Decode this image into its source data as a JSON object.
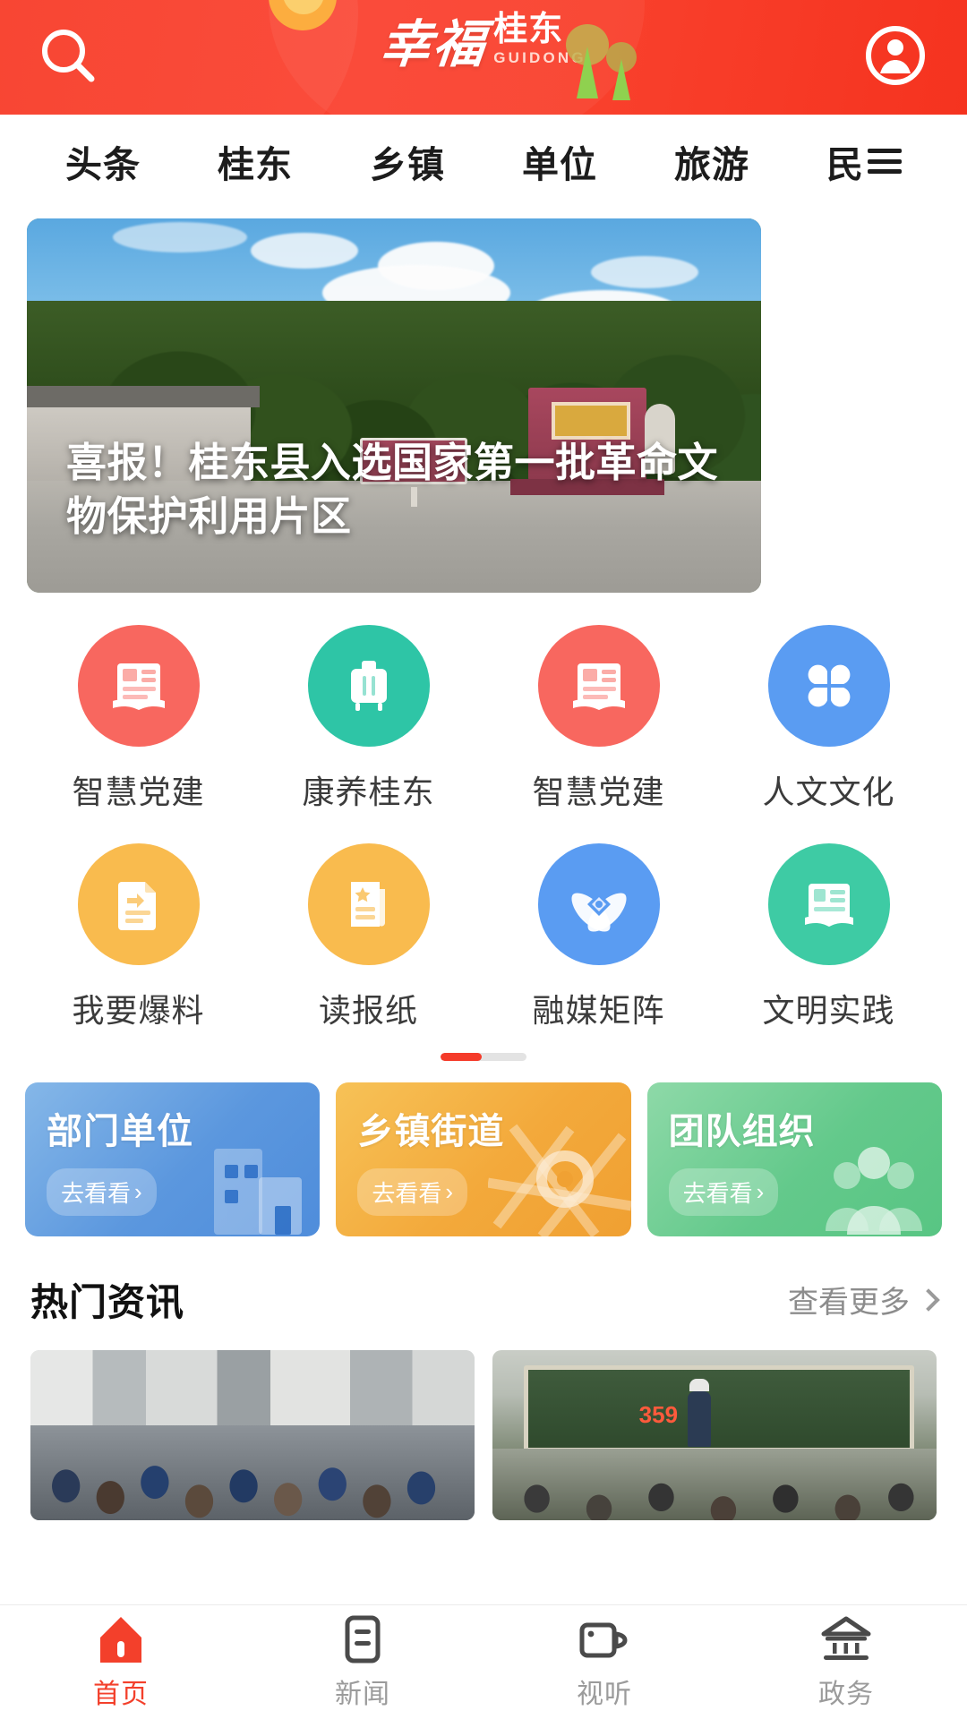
{
  "header": {
    "brand_cn": "幸福",
    "brand_sub": "桂东",
    "brand_en": "GUIDONG",
    "search_icon": "search-icon",
    "profile_icon": "user-avatar-icon",
    "tree_icon": "trees-icon",
    "brand_color": "#f8402b"
  },
  "tabs": [
    {
      "label": "头条"
    },
    {
      "label": "桂东"
    },
    {
      "label": "乡镇"
    },
    {
      "label": "单位"
    },
    {
      "label": "旅游"
    },
    {
      "label": "民"
    }
  ],
  "hero": {
    "title": "喜报！桂东县入选国家第一批革命文物保护利用片区"
  },
  "shortcuts": {
    "rows": [
      [
        {
          "label": "智慧党建",
          "color": "#f8675f",
          "icon": "party-book-icon"
        },
        {
          "label": "康养桂东",
          "color": "#2ec5a6",
          "icon": "suitcase-icon"
        },
        {
          "label": "智慧党建",
          "color": "#f8675f",
          "icon": "party-book-icon"
        },
        {
          "label": "人文文化",
          "color": "#5a9cf2",
          "icon": "four-petal-icon"
        }
      ],
      [
        {
          "label": "我要爆料",
          "color": "#f9bb4e",
          "icon": "upload-doc-icon"
        },
        {
          "label": "读报纸",
          "color": "#f9bb4e",
          "icon": "newspaper-icon"
        },
        {
          "label": "融媒矩阵",
          "color": "#5a9cf2",
          "icon": "media-atom-icon"
        },
        {
          "label": "文明实践",
          "color": "#3ecba4",
          "icon": "open-book-icon"
        }
      ]
    ],
    "pager": {
      "pages": 2,
      "current": 1,
      "active_color": "#f53b2a"
    }
  },
  "promos": [
    {
      "title": "部门单位",
      "cta": "去看看",
      "theme": "blue",
      "art": "buildings-icon"
    },
    {
      "title": "乡镇街道",
      "cta": "去看看",
      "theme": "orange",
      "art": "map-roads-icon"
    },
    {
      "title": "团队组织",
      "cta": "去看看",
      "theme": "green",
      "art": "people-group-icon"
    }
  ],
  "hot_news": {
    "title": "热门资讯",
    "more_label": "查看更多",
    "items": [
      {
        "thumb": "street-market-photo"
      },
      {
        "thumb": "classroom-lecture-photo",
        "screen_number": "359"
      }
    ]
  },
  "bottom_nav": {
    "active_color": "#f3402b",
    "items": [
      {
        "label": "首页",
        "icon": "home-icon",
        "active": true
      },
      {
        "label": "新闻",
        "icon": "news-icon",
        "active": false
      },
      {
        "label": "视听",
        "icon": "video-icon",
        "active": false
      },
      {
        "label": "政务",
        "icon": "government-icon",
        "active": false
      }
    ]
  }
}
